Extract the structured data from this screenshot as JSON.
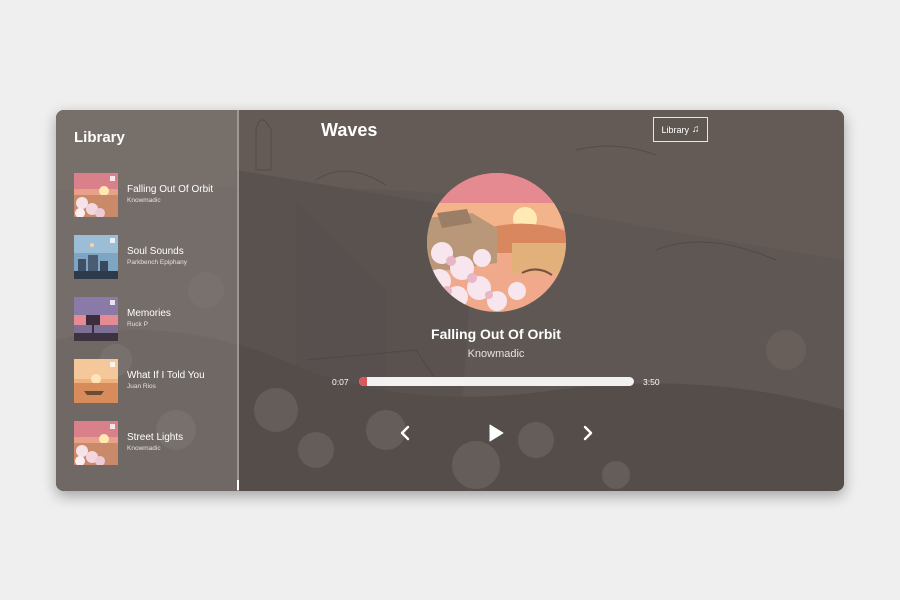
{
  "app": {
    "title": "Waves"
  },
  "header": {
    "library_button_label": "Library",
    "library_button_icon": "music-note-icon"
  },
  "library": {
    "title": "Library",
    "songs": [
      {
        "title": "Falling Out Of Orbit",
        "artist": "Knowmadic",
        "art": "pink-sunset-blossoms"
      },
      {
        "title": "Soul Sounds",
        "artist": "Parkbench Epiphany",
        "art": "blue-dusk-city"
      },
      {
        "title": "Memories",
        "artist": "Ruck P",
        "art": "purple-sunset-billboard"
      },
      {
        "title": "What If I Told You",
        "artist": "Juan Rios",
        "art": "orange-boat-sunset"
      },
      {
        "title": "Street Lights",
        "artist": "Knowmadic",
        "art": "pink-sunset-blossoms"
      }
    ]
  },
  "player": {
    "song_title": "Falling Out Of Orbit",
    "artist": "Knowmadic",
    "current_time": "0:07",
    "total_time": "3:50",
    "progress": 0.03,
    "icons": {
      "previous": "chevron-left-icon",
      "play": "play-icon",
      "next": "chevron-right-icon"
    }
  },
  "colors": {
    "accent": "#d9585e",
    "track": "#f2f2f2",
    "text": "#ffffff"
  }
}
